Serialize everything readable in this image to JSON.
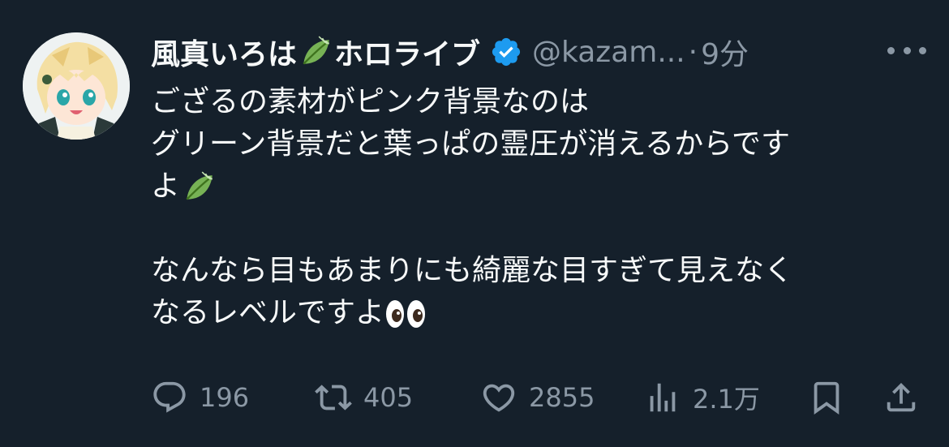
{
  "tweet": {
    "display_name": "風真いろは",
    "name_suffix": "ホロライブ",
    "handle": "@kazam...",
    "separator": "·",
    "time": "9分",
    "verified": true,
    "accent_color": "#1d9bf0",
    "lines": [
      "ござるの素材がピンク背景なのは",
      "グリーン背景だと葉っぱの霊圧が消えるからです",
      "よ",
      "",
      "なんなら目もあまりにも綺麗な目すぎて見えなく",
      "なるレベルですよ"
    ],
    "icons": {
      "leaf": "leaf-emoji",
      "eyes": "eyes-emoji",
      "verified": "verified-badge-icon",
      "more": "more-icon"
    }
  },
  "actions": {
    "reply": {
      "icon": "reply-icon",
      "count": "196"
    },
    "retweet": {
      "icon": "retweet-icon",
      "count": "405"
    },
    "like": {
      "icon": "heart-icon",
      "count": "2855"
    },
    "views": {
      "icon": "views-icon",
      "count": "2.1万"
    },
    "bookmark": {
      "icon": "bookmark-icon"
    },
    "share": {
      "icon": "share-icon"
    }
  }
}
